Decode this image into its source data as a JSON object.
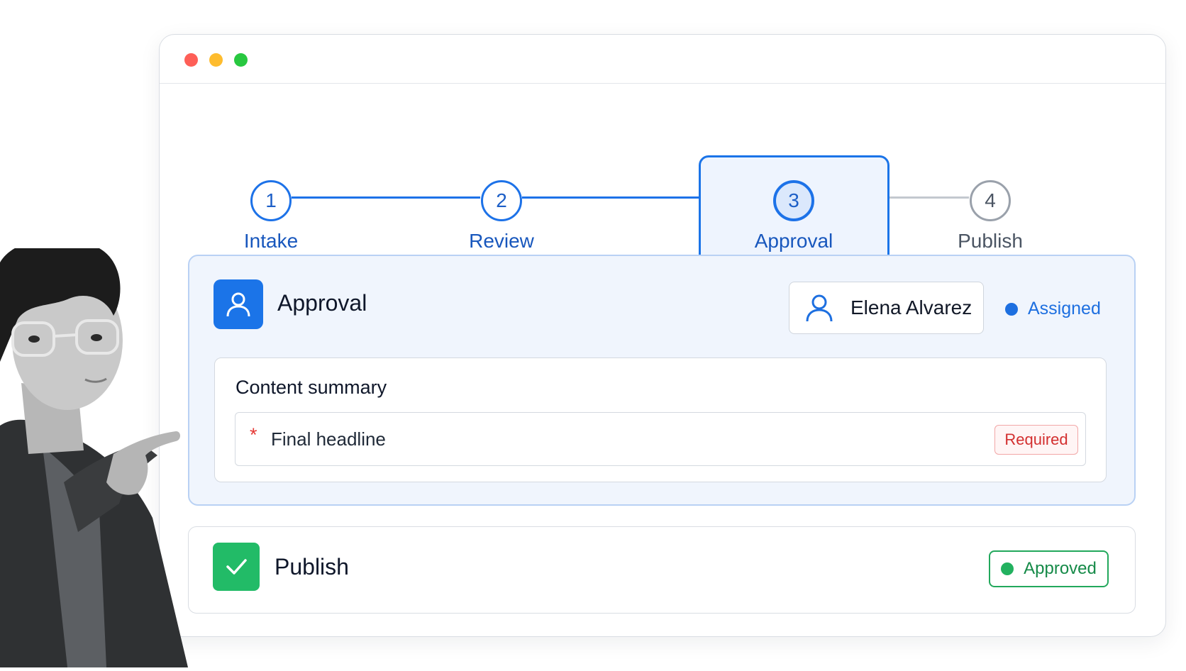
{
  "window": {
    "controls": [
      "close",
      "minimize",
      "zoom"
    ]
  },
  "stepper": {
    "steps": [
      {
        "number": "1",
        "label": "Intake",
        "state": "done"
      },
      {
        "number": "2",
        "label": "Review",
        "state": "done"
      },
      {
        "number": "3",
        "label": "Approval",
        "state": "active"
      },
      {
        "number": "4",
        "label": "Publish",
        "state": "todo"
      }
    ]
  },
  "approval": {
    "title": "Approval",
    "icon": "user-icon",
    "assignee": {
      "name": "Elena Alvarez",
      "icon": "user-icon"
    },
    "status": {
      "label": "Assigned",
      "color": "#1d6fe0"
    },
    "content_summary": {
      "title": "Content summary",
      "field": {
        "required_marker": "*",
        "label": "Final headline",
        "badge": "Required"
      }
    }
  },
  "publish": {
    "title": "Publish",
    "icon": "checkmark-icon",
    "status": {
      "label": "Approved",
      "color": "#22b15f"
    }
  },
  "colors": {
    "accent": "#1b74e8",
    "success": "#22bb67",
    "error": "#d32f2f"
  }
}
